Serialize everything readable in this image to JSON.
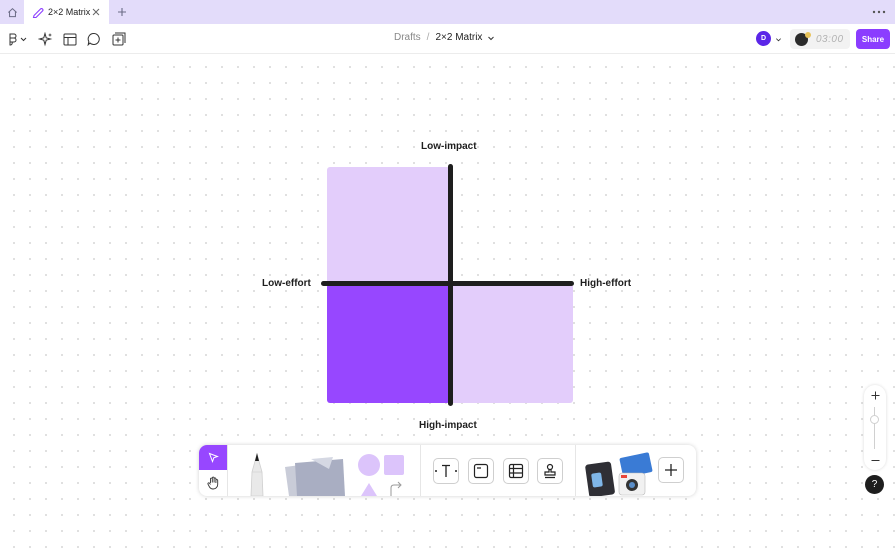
{
  "tab": {
    "title": "2×2 Matrix"
  },
  "breadcrumb": {
    "parent": "Drafts",
    "separator": "/",
    "file": "2×2 Matrix"
  },
  "user": {
    "initial": "D"
  },
  "timer": {
    "value": "03:00"
  },
  "share": {
    "label": "Share"
  },
  "matrix": {
    "top_label": "Low-impact",
    "bottom_label": "High-impact",
    "left_label": "Low-effort",
    "right_label": "High-effort"
  },
  "help": {
    "label": "?"
  },
  "colors": {
    "accent": "#9747ff",
    "light_quadrant": "#e3cdfb",
    "axis": "#1e1e1e",
    "tabbar": "#e3dcfa",
    "share_button": "#8b3dff"
  }
}
